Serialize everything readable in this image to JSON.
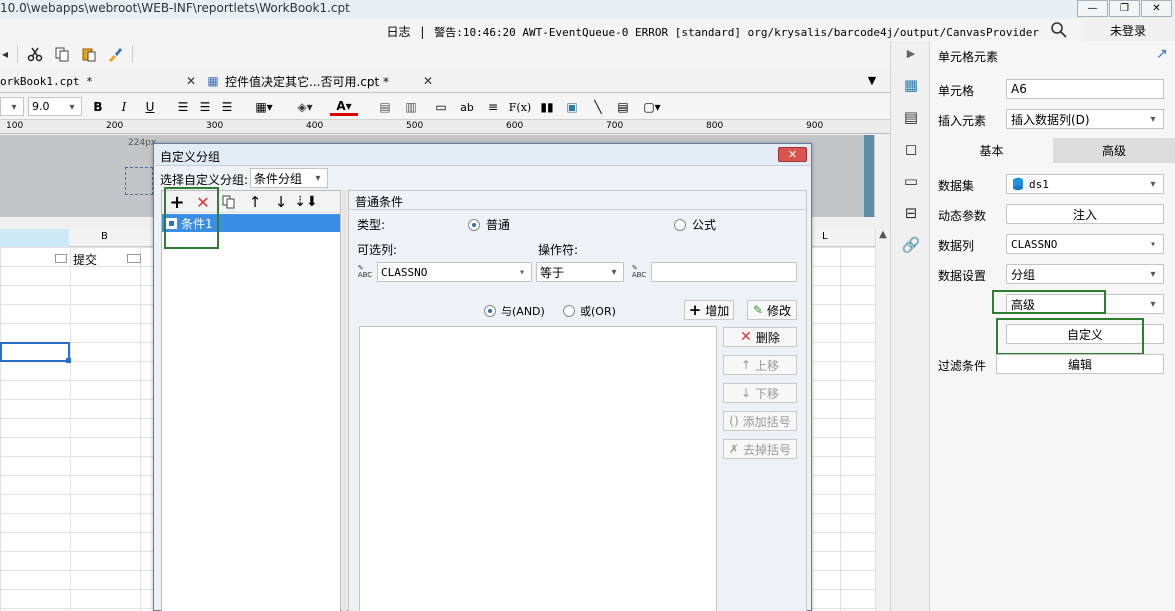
{
  "window": {
    "title": "10.0\\webapps\\webroot\\WEB-INF\\reportlets\\WorkBook1.cpt",
    "controls": [
      "—",
      "❐",
      "✕"
    ]
  },
  "statusbar": {
    "log_label": "日志",
    "warning": "警告:10:46:20 AWT-EventQueue-0 ERROR [standard] org/krysalis/barcode4j/output/CanvasProvider",
    "login": "未登录"
  },
  "tabs": [
    {
      "label": "orkBook1.cpt *",
      "close": "✕"
    },
    {
      "label": "控件值决定其它...否可用.cpt *",
      "close": "✕"
    }
  ],
  "format_toolbar": {
    "font_size": "9.0"
  },
  "ruler": {
    "ticks": [
      "100",
      "200",
      "300",
      "400",
      "500",
      "600",
      "700",
      "800",
      "900"
    ],
    "marker": "224px"
  },
  "sheet": {
    "columns": [
      "B",
      "L"
    ],
    "cell_b1": "提交"
  },
  "dialog": {
    "title": "自定义分组",
    "close": "✕",
    "select_label": "选择自定义分组:",
    "select_value": "条件分组",
    "tree": {
      "items": [
        "条件1"
      ]
    },
    "condition": {
      "section_title": "普通条件",
      "type_label": "类型:",
      "type_normal": "普通",
      "type_formula": "公式",
      "column_label": "可选列:",
      "operator_label": "操作符:",
      "column_value": "CLASSNO",
      "operator_value": "等于",
      "value_input": "",
      "and_label": "与(AND)",
      "or_label": "或(OR)",
      "add_button": "增加",
      "modify_button": "修改",
      "delete_button": "删除",
      "up_button": "上移",
      "down_button": "下移",
      "add_bracket_button": "添加括号",
      "remove_bracket_button": "去掉括号"
    }
  },
  "panel": {
    "title": "单元格元素",
    "cell_label": "单元格",
    "cell_value": "A6",
    "insert_label": "插入元素",
    "insert_value": "插入数据列(D)",
    "tab_basic": "基本",
    "tab_advanced": "高级",
    "dataset_label": "数据集",
    "dataset_value": "ds1",
    "dynamic_label": "动态参数",
    "inject_button": "注入",
    "column_label": "数据列",
    "column_value": "CLASSNO",
    "setting_label": "数据设置",
    "setting_value": "分组",
    "group_mode_value": "高级",
    "custom_button": "自定义",
    "filter_label": "过滤条件",
    "edit_button": "编辑"
  },
  "colors": {
    "accent": "#2a6fc9",
    "highlight_box": "#2f7d2f",
    "close_red": "#d9534f",
    "dataset_icon": "#1e90e0",
    "delete_red": "#e03030"
  }
}
